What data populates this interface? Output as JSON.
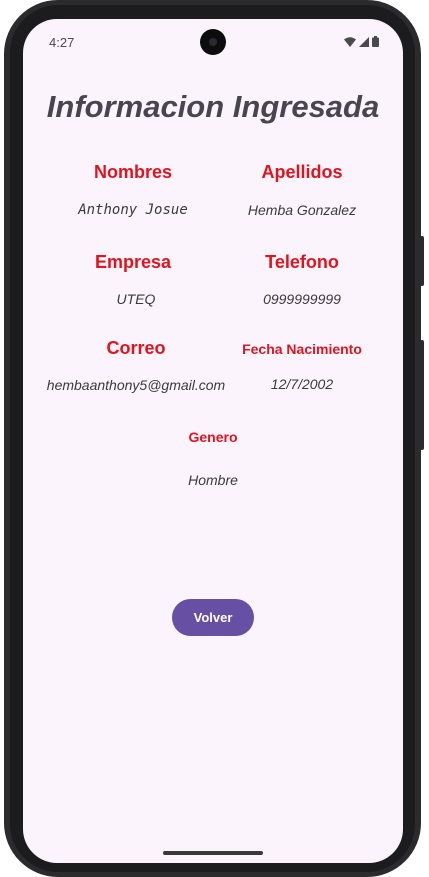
{
  "status_bar": {
    "time": "4:27"
  },
  "page": {
    "title": "Informacion Ingresada"
  },
  "fields": {
    "nombres": {
      "label": "Nombres",
      "value": "Anthony Josue"
    },
    "apellidos": {
      "label": "Apellidos",
      "value": "Hemba Gonzalez"
    },
    "empresa": {
      "label": "Empresa",
      "value": "UTEQ"
    },
    "telefono": {
      "label": "Telefono",
      "value": "0999999999"
    },
    "correo": {
      "label": "Correo",
      "value": "hembaanthony5@gmail.com"
    },
    "fecha_nacimiento": {
      "label": "Fecha Nacimiento",
      "value": "12/7/2002"
    },
    "genero": {
      "label": "Genero",
      "value": "Hombre"
    }
  },
  "actions": {
    "back_label": "Volver"
  },
  "colors": {
    "label": "#e0141e",
    "button": "#6750a4",
    "background": "#fcf4fc"
  }
}
